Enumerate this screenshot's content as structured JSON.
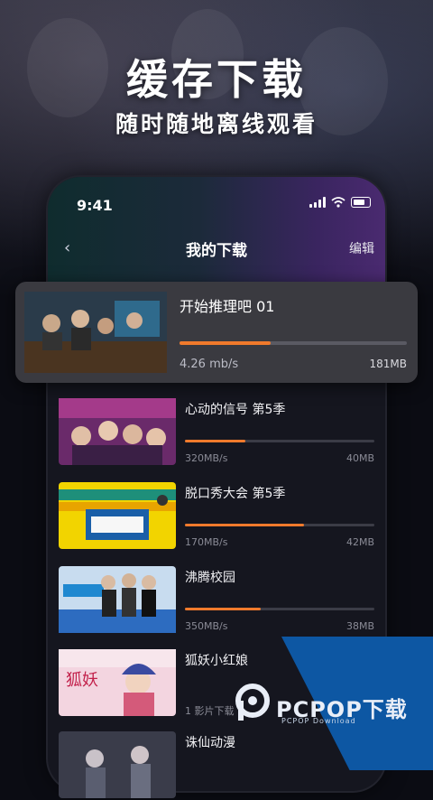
{
  "banner": {
    "headline": "缓存下载",
    "subline": "随时随地离线观看"
  },
  "status_bar": {
    "time": "9:41",
    "icons": [
      "signal-icon",
      "wifi-icon",
      "battery-icon"
    ]
  },
  "nav": {
    "back_icon": "chevron-left-icon",
    "title": "我的下载",
    "edit_label": "编辑"
  },
  "featured": {
    "title": "开始推理吧 01",
    "progress": 0.4,
    "speed": "4.26 mb/s",
    "size": "181MB"
  },
  "downloads": [
    {
      "title": "心动的信号 第5季",
      "progress": 0.32,
      "speed": "320MB/s",
      "size": "40MB"
    },
    {
      "title": "脱口秀大会 第5季",
      "progress": 0.63,
      "speed": "170MB/s",
      "size": "42MB"
    },
    {
      "title": "沸腾校园",
      "progress": 0.4,
      "speed": "350MB/s",
      "size": "38MB"
    },
    {
      "title": "狐妖小红娘",
      "progress": 0,
      "speed": "1 影片下载",
      "size": ""
    },
    {
      "title": "诛仙动漫",
      "progress": 0,
      "speed": "",
      "size": ""
    }
  ],
  "watermark": {
    "text": "PCPOP下载",
    "sub": "PCPOP Download"
  },
  "colors": {
    "accent": "#f07a2c",
    "watermark_blue": "#0d57a3"
  }
}
